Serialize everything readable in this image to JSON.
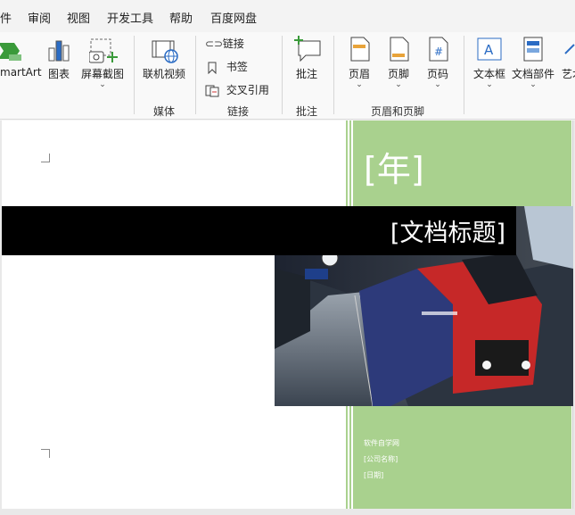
{
  "menu": {
    "items": [
      "件",
      "审阅",
      "视图",
      "开发工具",
      "帮助",
      "百度网盘"
    ]
  },
  "ribbon": {
    "smartart_label": "martArt",
    "chart_label": "图表",
    "screenshot_label": "屏幕截图",
    "online_video_label": "联机视频",
    "link_label": "链接",
    "bookmark_label": "书签",
    "crossref_label": "交叉引用",
    "comment_label": "批注",
    "header_label": "页眉",
    "footer_label": "页脚",
    "page_number_label": "页码",
    "textbox_label": "文本框",
    "quickparts_label": "文档部件",
    "wordart_label": "艺术",
    "groups": {
      "media": "媒体",
      "links": "链接",
      "comments": "批注",
      "header_footer": "页眉和页脚"
    },
    "page_number_glyph": "#",
    "textbox_glyph": "A"
  },
  "document": {
    "year_placeholder": "[年]",
    "title_placeholder": "[文档标题]",
    "author": "软件自学网",
    "company": "[公司名称]",
    "date": "[日期]"
  },
  "colors": {
    "accent_green": "#a9d18e",
    "title_bar": "#000000",
    "icon_blue": "#2b6cc4",
    "icon_green": "#3a9a3a"
  }
}
